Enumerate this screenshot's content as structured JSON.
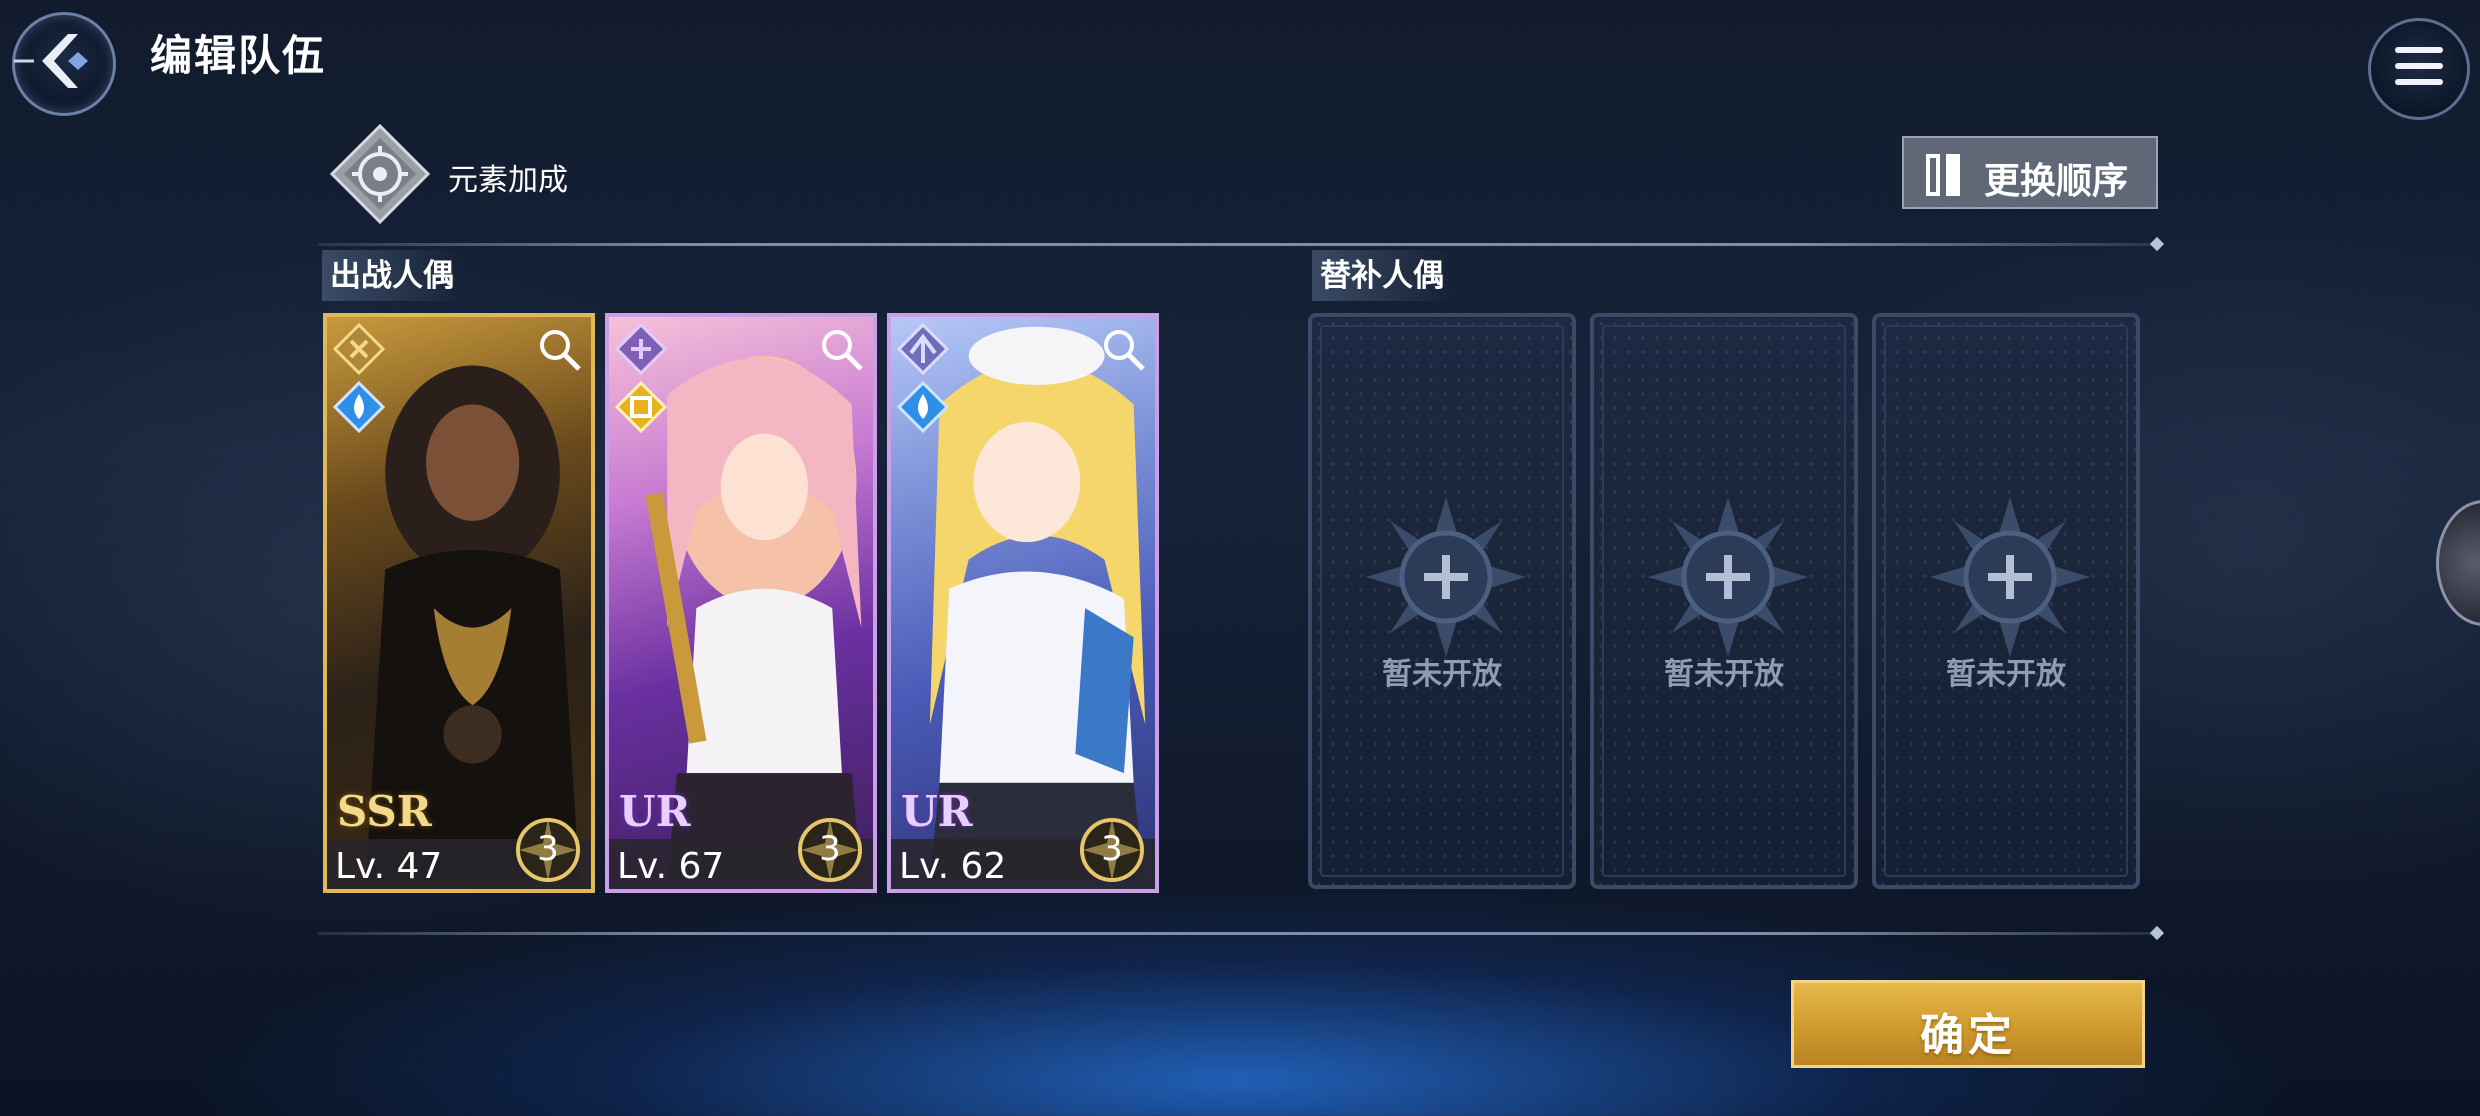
{
  "header": {
    "title": "编辑队伍"
  },
  "element_bonus": {
    "label": "元素加成"
  },
  "order_button": {
    "label": "更换顺序"
  },
  "sections": {
    "active_label": "出战人偶",
    "reserve_label": "替补人偶"
  },
  "active_dolls": [
    {
      "rarity": "SSR",
      "level": "Lv. 47",
      "stars": "3",
      "element": "water-drop-icon"
    },
    {
      "rarity": "UR",
      "level": "Lv. 67",
      "stars": "3",
      "element": "light-gem-icon"
    },
    {
      "rarity": "UR",
      "level": "Lv. 62",
      "stars": "3",
      "element": "water-drop-icon"
    }
  ],
  "reserve_slots": [
    {
      "status": "暂未开放"
    },
    {
      "status": "暂未开放"
    },
    {
      "status": "暂未开放"
    }
  ],
  "confirm_button": {
    "label": "确定"
  },
  "colors": {
    "accent_gold": "#d9a83a",
    "ssr_border": "#e0b856",
    "ur_border": "#c9a0e8",
    "water_element": "#2f8fe6"
  }
}
